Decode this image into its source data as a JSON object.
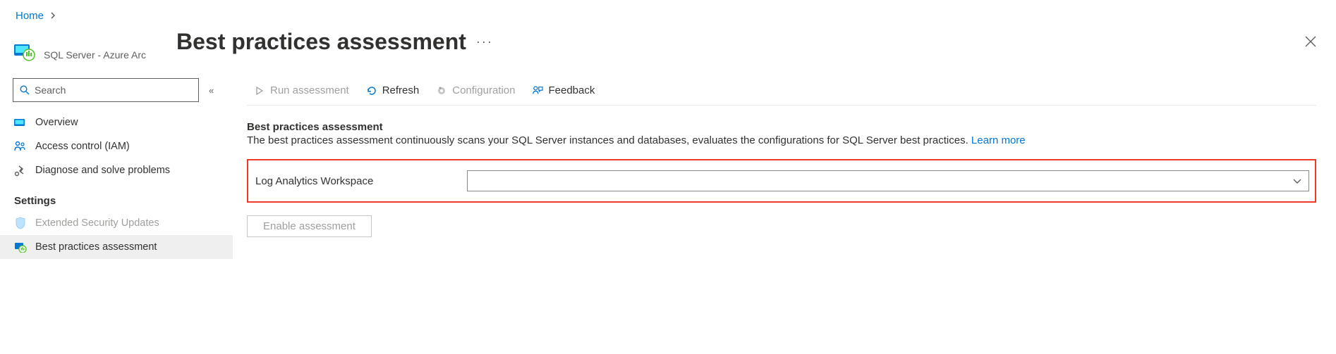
{
  "breadcrumb": {
    "home": "Home"
  },
  "sidebar": {
    "resource_type": "SQL Server - Azure Arc",
    "search_placeholder": "Search",
    "items": [
      {
        "label": "Overview"
      },
      {
        "label": "Access control (IAM)"
      },
      {
        "label": "Diagnose and solve problems"
      }
    ],
    "section_settings": "Settings",
    "settings_items": [
      {
        "label": "Extended Security Updates"
      },
      {
        "label": "Best practices assessment"
      }
    ]
  },
  "page": {
    "title": "Best practices assessment",
    "more": "···"
  },
  "commands": {
    "run": "Run assessment",
    "refresh": "Refresh",
    "configuration": "Configuration",
    "feedback": "Feedback"
  },
  "section": {
    "heading": "Best practices assessment",
    "description": "The best practices assessment continuously scans your SQL Server instances and databases, evaluates the configurations for SQL Server best practices. ",
    "learn_more": "Learn more"
  },
  "form": {
    "workspace_label": "Log Analytics Workspace",
    "workspace_value": "",
    "enable_button": "Enable assessment"
  }
}
